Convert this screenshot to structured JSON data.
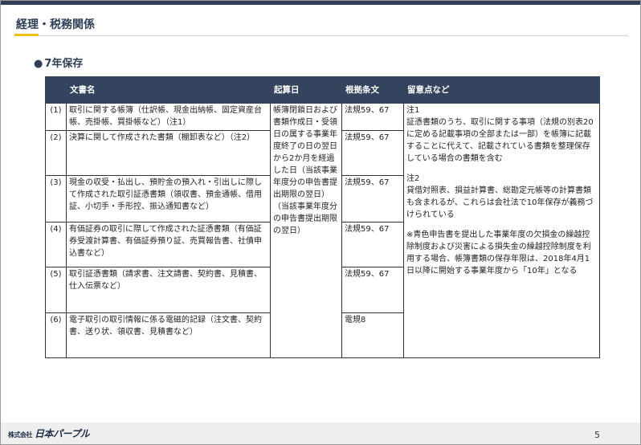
{
  "header": {
    "title": "経理・税務関係",
    "accent": "#f0c010",
    "bar_color": "#2f3f57"
  },
  "section": {
    "bullet": "●",
    "label": "7年保存"
  },
  "table": {
    "headers": {
      "no": "",
      "name": "文書名",
      "start": "起算日",
      "law": "根拠条文",
      "notes": "留意点など"
    },
    "rows": [
      {
        "no": "(1)",
        "name": "取引に関する帳簿（仕訳帳、現金出納帳、固定資産台帳、売掛帳、買掛帳など）（注1）",
        "law": "法規59、67"
      },
      {
        "no": "(2)",
        "name": "決算に関して作成された書類（棚卸表など）（注2）",
        "law": "法規59、67"
      },
      {
        "no": "(3)",
        "name": "現金の収受・払出し、預貯金の預入れ・引出しに際して作成された取引証憑書類（領収書、預金通帳、借用証、小切手・手形控、振込通知書など）",
        "law": "法規59、67"
      },
      {
        "no": "(4)",
        "name": "有価証券の取引に際して作成された証憑書類（有価証券受渡計算書、有価証券預り証、売買報告書、社債申込書など）",
        "law": "法規59、67"
      },
      {
        "no": "(5)",
        "name": "取引証憑書類（請求書、注文請書、契約書、見積書、仕入伝票など）",
        "law": "法規59、67"
      },
      {
        "no": "(6)",
        "name": "電子取引の取引情報に係る電磁的記録（注文書、契約書、送り状、領収書、見積書など）",
        "law": "電規8"
      }
    ],
    "start_text": "帳簿閉鎖日および書類作成日・受領日の属する事業年度終了の日の翌日から2か月を経過した日（当該事業年度分の申告書提出期限の翌日）（当該事業年度分の申告書提出期限の翌日）",
    "notes": {
      "note1_title": "注1",
      "note1_body": "証憑書類のうち、取引に関する事項（法規の別表20に定める記載事項の全部または一部）を帳簿に記載することに代えて、記載されている書類を整理保存している場合の書類を含む",
      "note2_title": "注2",
      "note2_body": "貸借対照表、損益計算書、総勘定元帳等の計算書類も含まれるが、これらは会社法で10年保存が義務づけられている",
      "note3": "※青色申告書を提出した事業年度の欠損金の繰越控除制度および災害による損失金の繰越控除制度を利用する場合、帳簿書類の保存年限は、2018年4月1日以降に開始する事業年度から「10年」となる"
    }
  },
  "footer": {
    "logo_small": "株式会社",
    "logo_main": "日本パープル",
    "page": "5"
  }
}
